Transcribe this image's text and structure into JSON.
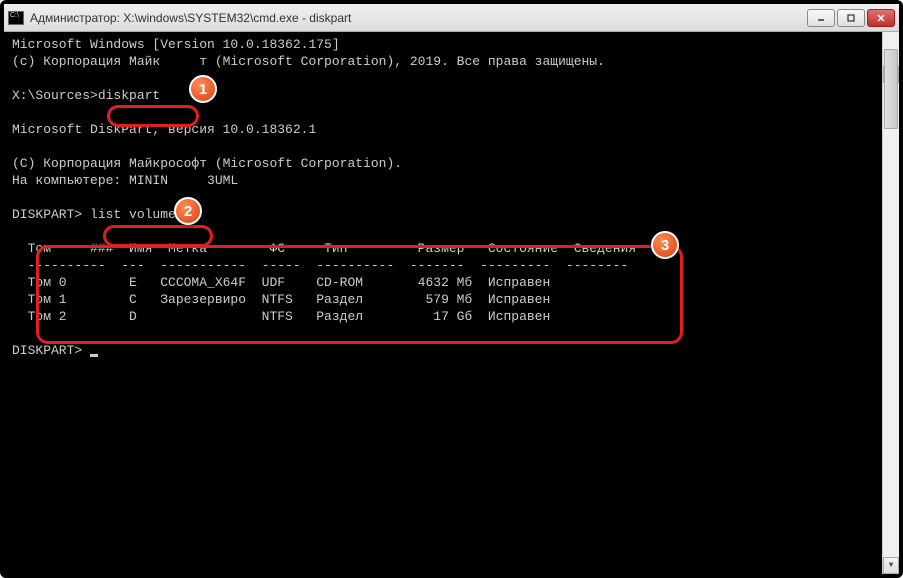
{
  "window": {
    "title": "Администратор: X:\\windows\\SYSTEM32\\cmd.exe - diskpart"
  },
  "console": {
    "line1": "Microsoft Windows [Version 10.0.18362.175]",
    "line2": "(c) Корпорация Майк     т (Microsoft Corporation), 2019. Все права защищены.",
    "line3": "",
    "prompt1_pre": "X:\\Sources>",
    "prompt1_cmd": "diskpart",
    "line5": "",
    "line6": "Microsoft DiskPart, версия 10.0.18362.1",
    "line7": "",
    "line8": "(C) Корпорация Майкрософт (Microsoft Corporation).",
    "line9": "На компьютере: MININ     3UML",
    "line10": "",
    "prompt2_pre": "DISKPART> ",
    "prompt2_cmd": "list volume",
    "line12": "",
    "header": "  Том     ###  Имя  Метка        ФС     Тип         Размер   Состояние  Сведения",
    "sep": "  ----------  ---  -----------  -----  ----------  -------  ---------  --------",
    "row0": "  Том 0        E   CCCOMA_X64F  UDF    CD-ROM       4632 Мб  Исправен",
    "row1": "  Том 1        C   Зарезервиро  NTFS   Раздел        579 Мб  Исправен",
    "row2": "  Том 2        D                NTFS   Раздел         17 Gб  Исправен",
    "line18": "",
    "prompt3": "DISKPART> "
  },
  "badges": {
    "b1": "1",
    "b2": "2",
    "b3": "3"
  }
}
